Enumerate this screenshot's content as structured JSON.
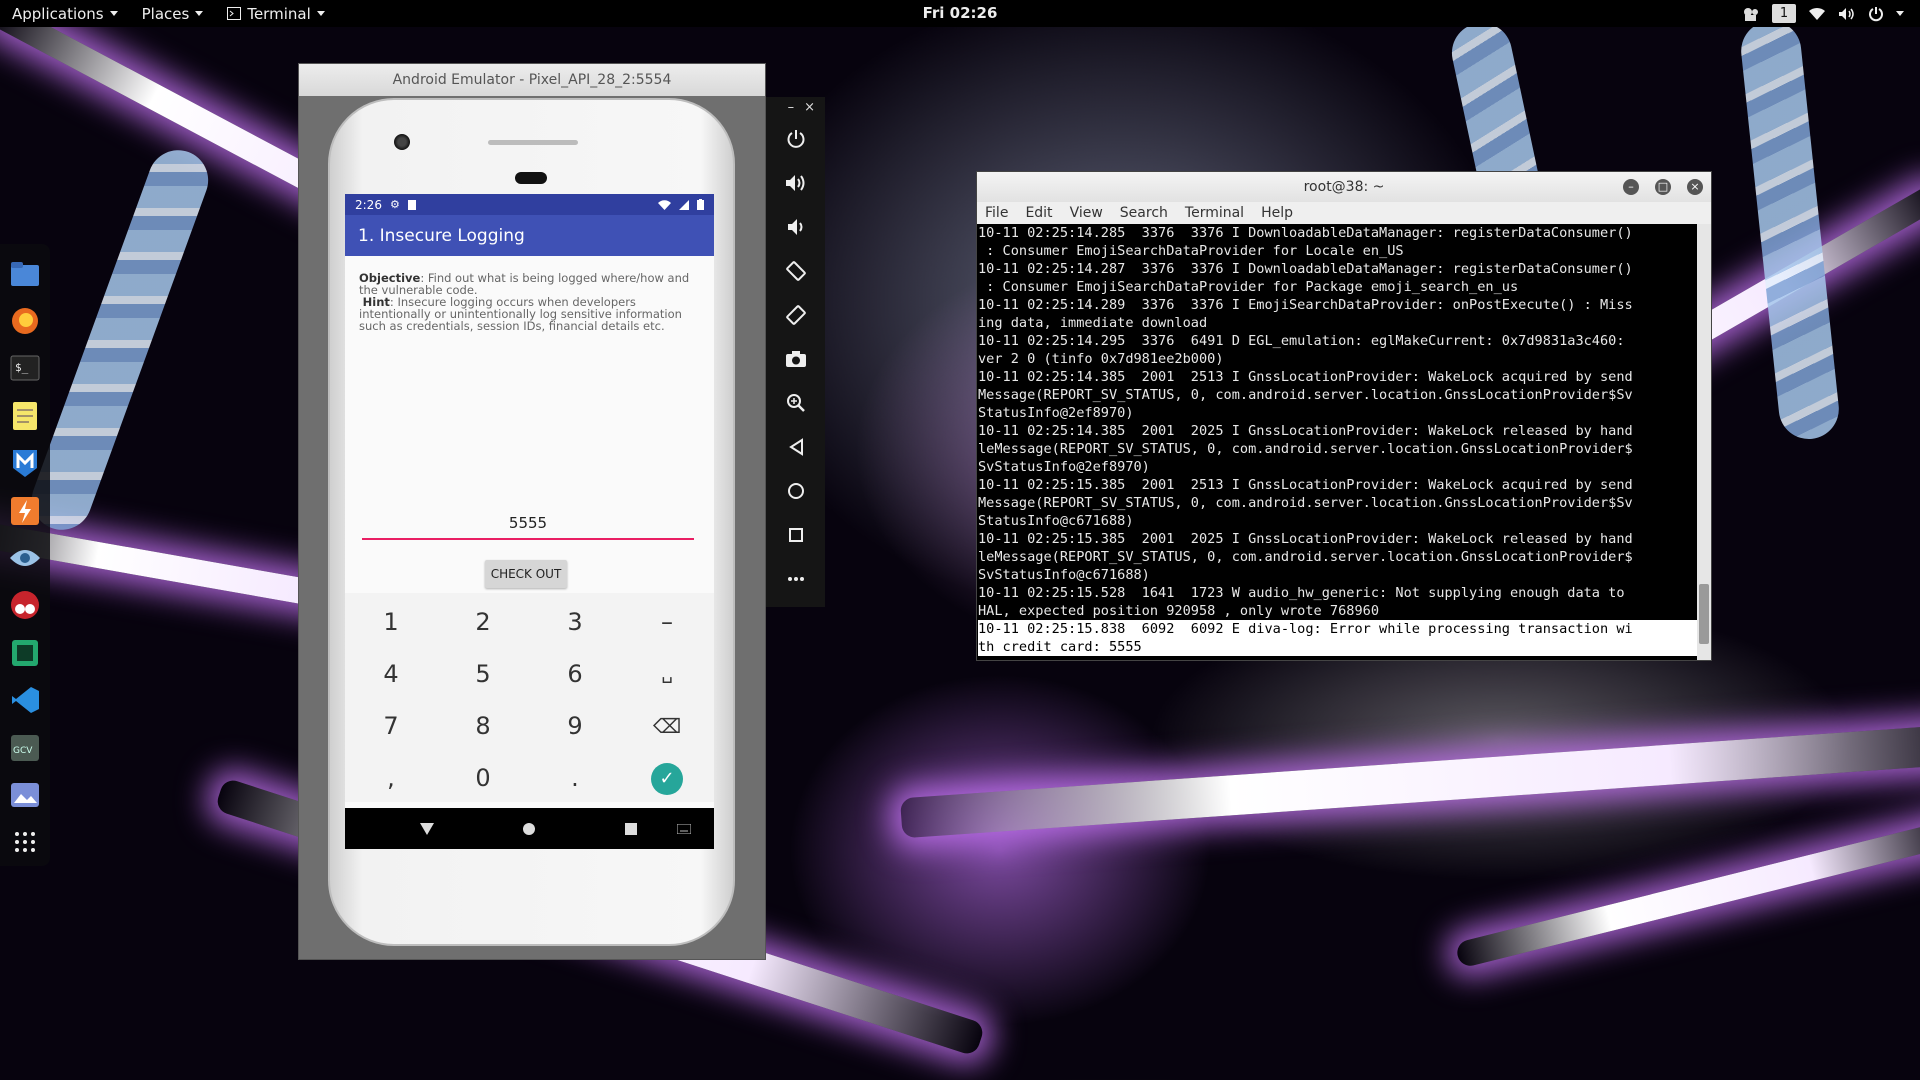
{
  "topbar": {
    "applications": "Applications",
    "places": "Places",
    "terminal": "Terminal",
    "clock": "Fri 02:26",
    "workspace": "1"
  },
  "dock": {
    "items": [
      "files-icon",
      "firefox-icon",
      "terminal-icon",
      "text-editor-icon",
      "metasploit-icon",
      "burpsuite-icon",
      "eye-icon",
      "cherrytree-icon",
      "app-icon",
      "vscode-icon",
      "gcv-icon",
      "image-viewer-icon",
      "show-applications-icon"
    ]
  },
  "emulator": {
    "title": "Android Emulator - Pixel_API_28_2:5554",
    "status_time": "2:26",
    "app_title": "1. Insecure Logging",
    "objective_label": "Objective",
    "objective_text": ": Find out what is being logged where/how and the vulnerable code.",
    "hint_label": "Hint",
    "hint_text": ": Insecure logging occurs when developers intentionally or unintentionally log sensitive information such as credentials, session IDs, financial details etc.",
    "input_value": "5555",
    "checkout_label": "CHECK OUT",
    "keys": [
      "1",
      "2",
      "3",
      "–",
      "4",
      "5",
      "6",
      "␣",
      "7",
      "8",
      "9",
      "⌫",
      ",",
      "0",
      ".",
      "✓"
    ]
  },
  "toolbar": {
    "minimize": "–",
    "close": "×"
  },
  "terminal": {
    "title": "root@38: ~",
    "menu": [
      "File",
      "Edit",
      "View",
      "Search",
      "Terminal",
      "Help"
    ],
    "lines": [
      "10-11 02:25:14.285  3376  3376 I DownloadableDataManager: registerDataConsumer()",
      " : Consumer EmojiSearchDataProvider for Locale en_US",
      "10-11 02:25:14.287  3376  3376 I DownloadableDataManager: registerDataConsumer()",
      " : Consumer EmojiSearchDataProvider for Package emoji_search_en_us",
      "10-11 02:25:14.289  3376  3376 I EmojiSearchDataProvider: onPostExecute() : Miss",
      "ing data, immediate download",
      "10-11 02:25:14.295  3376  6491 D EGL_emulation: eglMakeCurrent: 0x7d9831a3c460:",
      "ver 2 0 (tinfo 0x7d981ee2b000)",
      "10-11 02:25:14.385  2001  2513 I GnssLocationProvider: WakeLock acquired by send",
      "Message(REPORT_SV_STATUS, 0, com.android.server.location.GnssLocationProvider$Sv",
      "StatusInfo@2ef8970)",
      "10-11 02:25:14.385  2001  2025 I GnssLocationProvider: WakeLock released by hand",
      "leMessage(REPORT_SV_STATUS, 0, com.android.server.location.GnssLocationProvider$",
      "SvStatusInfo@2ef8970)",
      "10-11 02:25:15.385  2001  2513 I GnssLocationProvider: WakeLock acquired by send",
      "Message(REPORT_SV_STATUS, 0, com.android.server.location.GnssLocationProvider$Sv",
      "StatusInfo@c671688)",
      "10-11 02:25:15.385  2001  2025 I GnssLocationProvider: WakeLock released by hand",
      "leMessage(REPORT_SV_STATUS, 0, com.android.server.location.GnssLocationProvider$",
      "SvStatusInfo@c671688)",
      "10-11 02:25:15.528  1641  1723 W audio_hw_generic: Not supplying enough data to",
      "HAL, expected position 920958 , only wrote 768960",
      "10-11 02:25:15.838  6092  6092 E diva-log: Error while processing transaction wi",
      "th credit card: 5555"
    ]
  }
}
